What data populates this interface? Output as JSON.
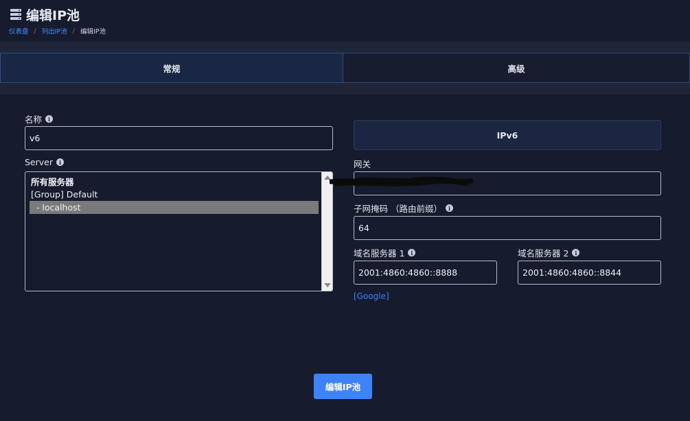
{
  "page": {
    "title": "编辑IP池",
    "icon": "server-stack-icon"
  },
  "breadcrumb": {
    "items": [
      "仪表盘",
      "列出IP池"
    ],
    "current": "编辑IP池",
    "separator": "/"
  },
  "tabs": [
    {
      "label": "常规",
      "active": true
    },
    {
      "label": "高级",
      "active": false
    }
  ],
  "form": {
    "name": {
      "label": "名称",
      "value": "v6"
    },
    "server": {
      "label": "Server",
      "options": [
        {
          "text": "所有服务器",
          "selected": false
        },
        {
          "text": "[Group] Default",
          "selected": false
        },
        {
          "text": "  - localhost",
          "selected": true
        }
      ]
    },
    "ip_version": {
      "label": "IPv6"
    },
    "gateway": {
      "label": "网关",
      "value": ""
    },
    "netmask": {
      "label": "子网掩码 （路由前缀）",
      "value": "64"
    },
    "ns1": {
      "label": "域名服务器 1",
      "value": "2001:4860:4860::8888"
    },
    "ns2": {
      "label": "域名服务器 2",
      "value": "2001:4860:4860::8844"
    },
    "dns_preset_link": "[Google]",
    "submit_label": "编辑IP池"
  },
  "colors": {
    "background": "#161b2d",
    "accent": "#3e82f7",
    "link": "#4b8cff",
    "tab_border": "#2b4f8a"
  }
}
